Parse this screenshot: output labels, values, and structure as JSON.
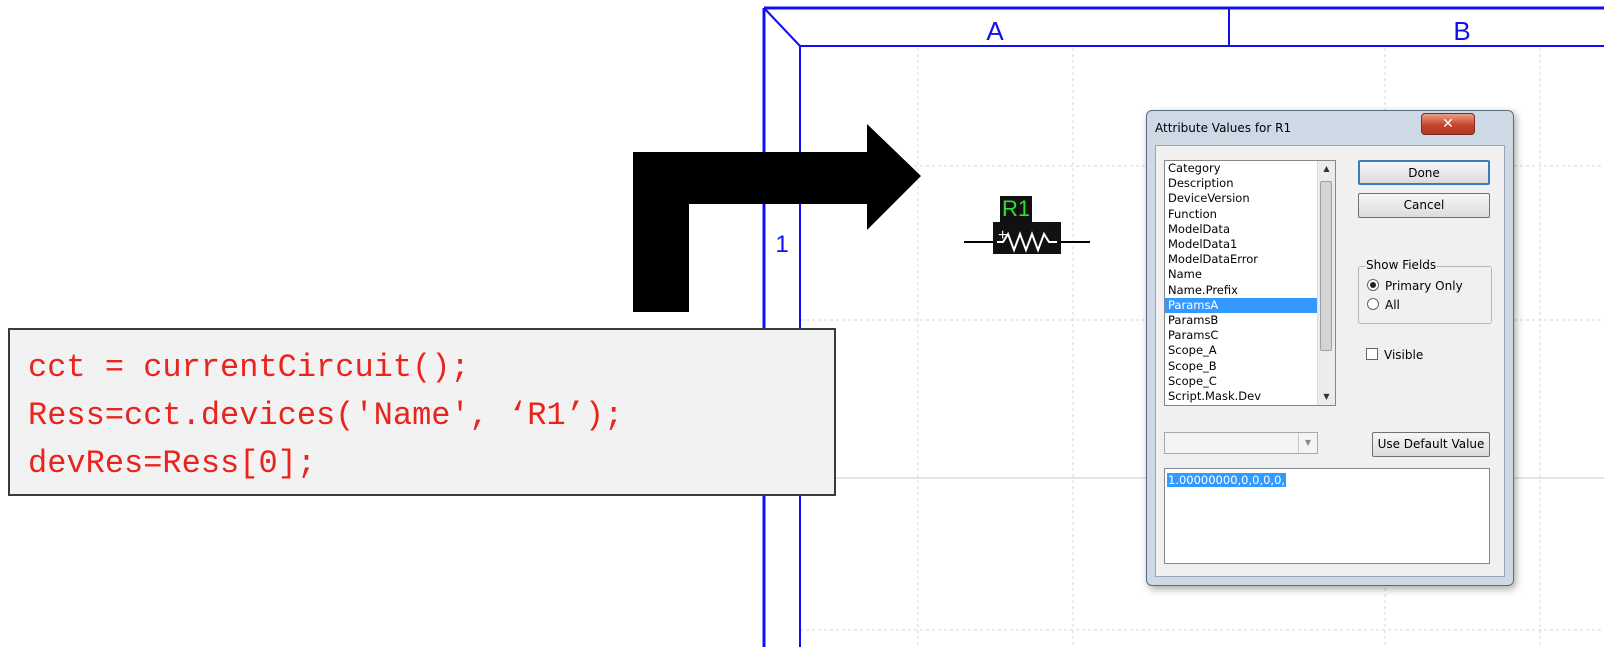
{
  "sheet": {
    "col_a_label": "A",
    "col_b_label": "B",
    "row_1_label": "1",
    "border_color": "#1010ee"
  },
  "code": {
    "lines": [
      "cct = currentCircuit();",
      "Ress=cct.devices('Name', ‘R1’);",
      "devRes=Ress[0];"
    ],
    "color": "#e8241c"
  },
  "resistor": {
    "name_label": "R1",
    "plus_label": "+"
  },
  "dialog": {
    "title": "Attribute Values for  R1",
    "close_label": "✕",
    "list_items": [
      "Category",
      "Description",
      "DeviceVersion",
      "Function",
      "ModelData",
      "ModelData1",
      "ModelDataError",
      "Name",
      "Name.Prefix",
      "ParamsA",
      "ParamsB",
      "ParamsC",
      "Scope_A",
      "Scope_B",
      "Scope_C",
      "Script.Mask.Dev"
    ],
    "selected_item": "ParamsA",
    "done_label": "Done",
    "cancel_label": "Cancel",
    "show_fields": {
      "legend": "Show Fields",
      "primary_label": "Primary Only",
      "all_label": "All",
      "selected": "Primary Only"
    },
    "visible_label": "Visible",
    "visible_checked": false,
    "combo_value": "",
    "default_button_label": "Use Default Value",
    "value_text": "1.00000000,0,0,0,0,"
  }
}
